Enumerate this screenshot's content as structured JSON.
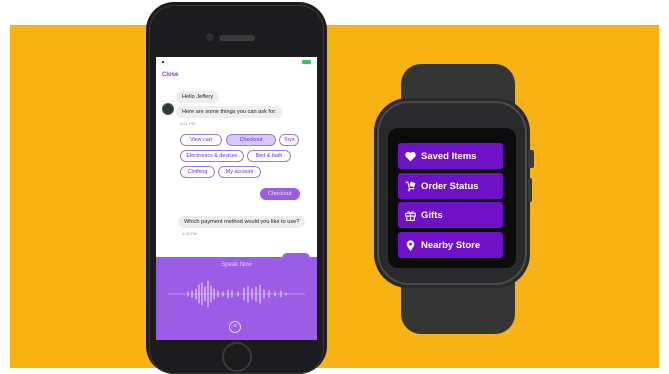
{
  "phone": {
    "close_label": "Close",
    "chat": {
      "bot_greeting": "Hello Jeffery",
      "bot_prompt": "Here are some things you can ask for:",
      "bot_prompt_time": "4:21 PM",
      "suggestions": [
        "View cart",
        "Checkout",
        "Toys",
        "Electronics & devices",
        "Bed & bath",
        "Clothing",
        "My account"
      ],
      "selected_suggestion": "Checkout",
      "user_message": "Checkout",
      "bot_question": "Which payment method would you like to use?",
      "bot_question_time": "4:22 PM"
    },
    "speak_label": "Speak Now"
  },
  "watch": {
    "menu": [
      {
        "label": "Saved Items",
        "icon": "heart-icon"
      },
      {
        "label": "Order Status",
        "icon": "delivery-icon"
      },
      {
        "label": "Gifts",
        "icon": "gift-icon"
      },
      {
        "label": "Nearby Store",
        "icon": "location-pin-icon"
      }
    ]
  },
  "colors": {
    "background_accent": "#F7B213",
    "watch_item": "#6E12C8",
    "phone_accent": "#9B5DE5"
  }
}
